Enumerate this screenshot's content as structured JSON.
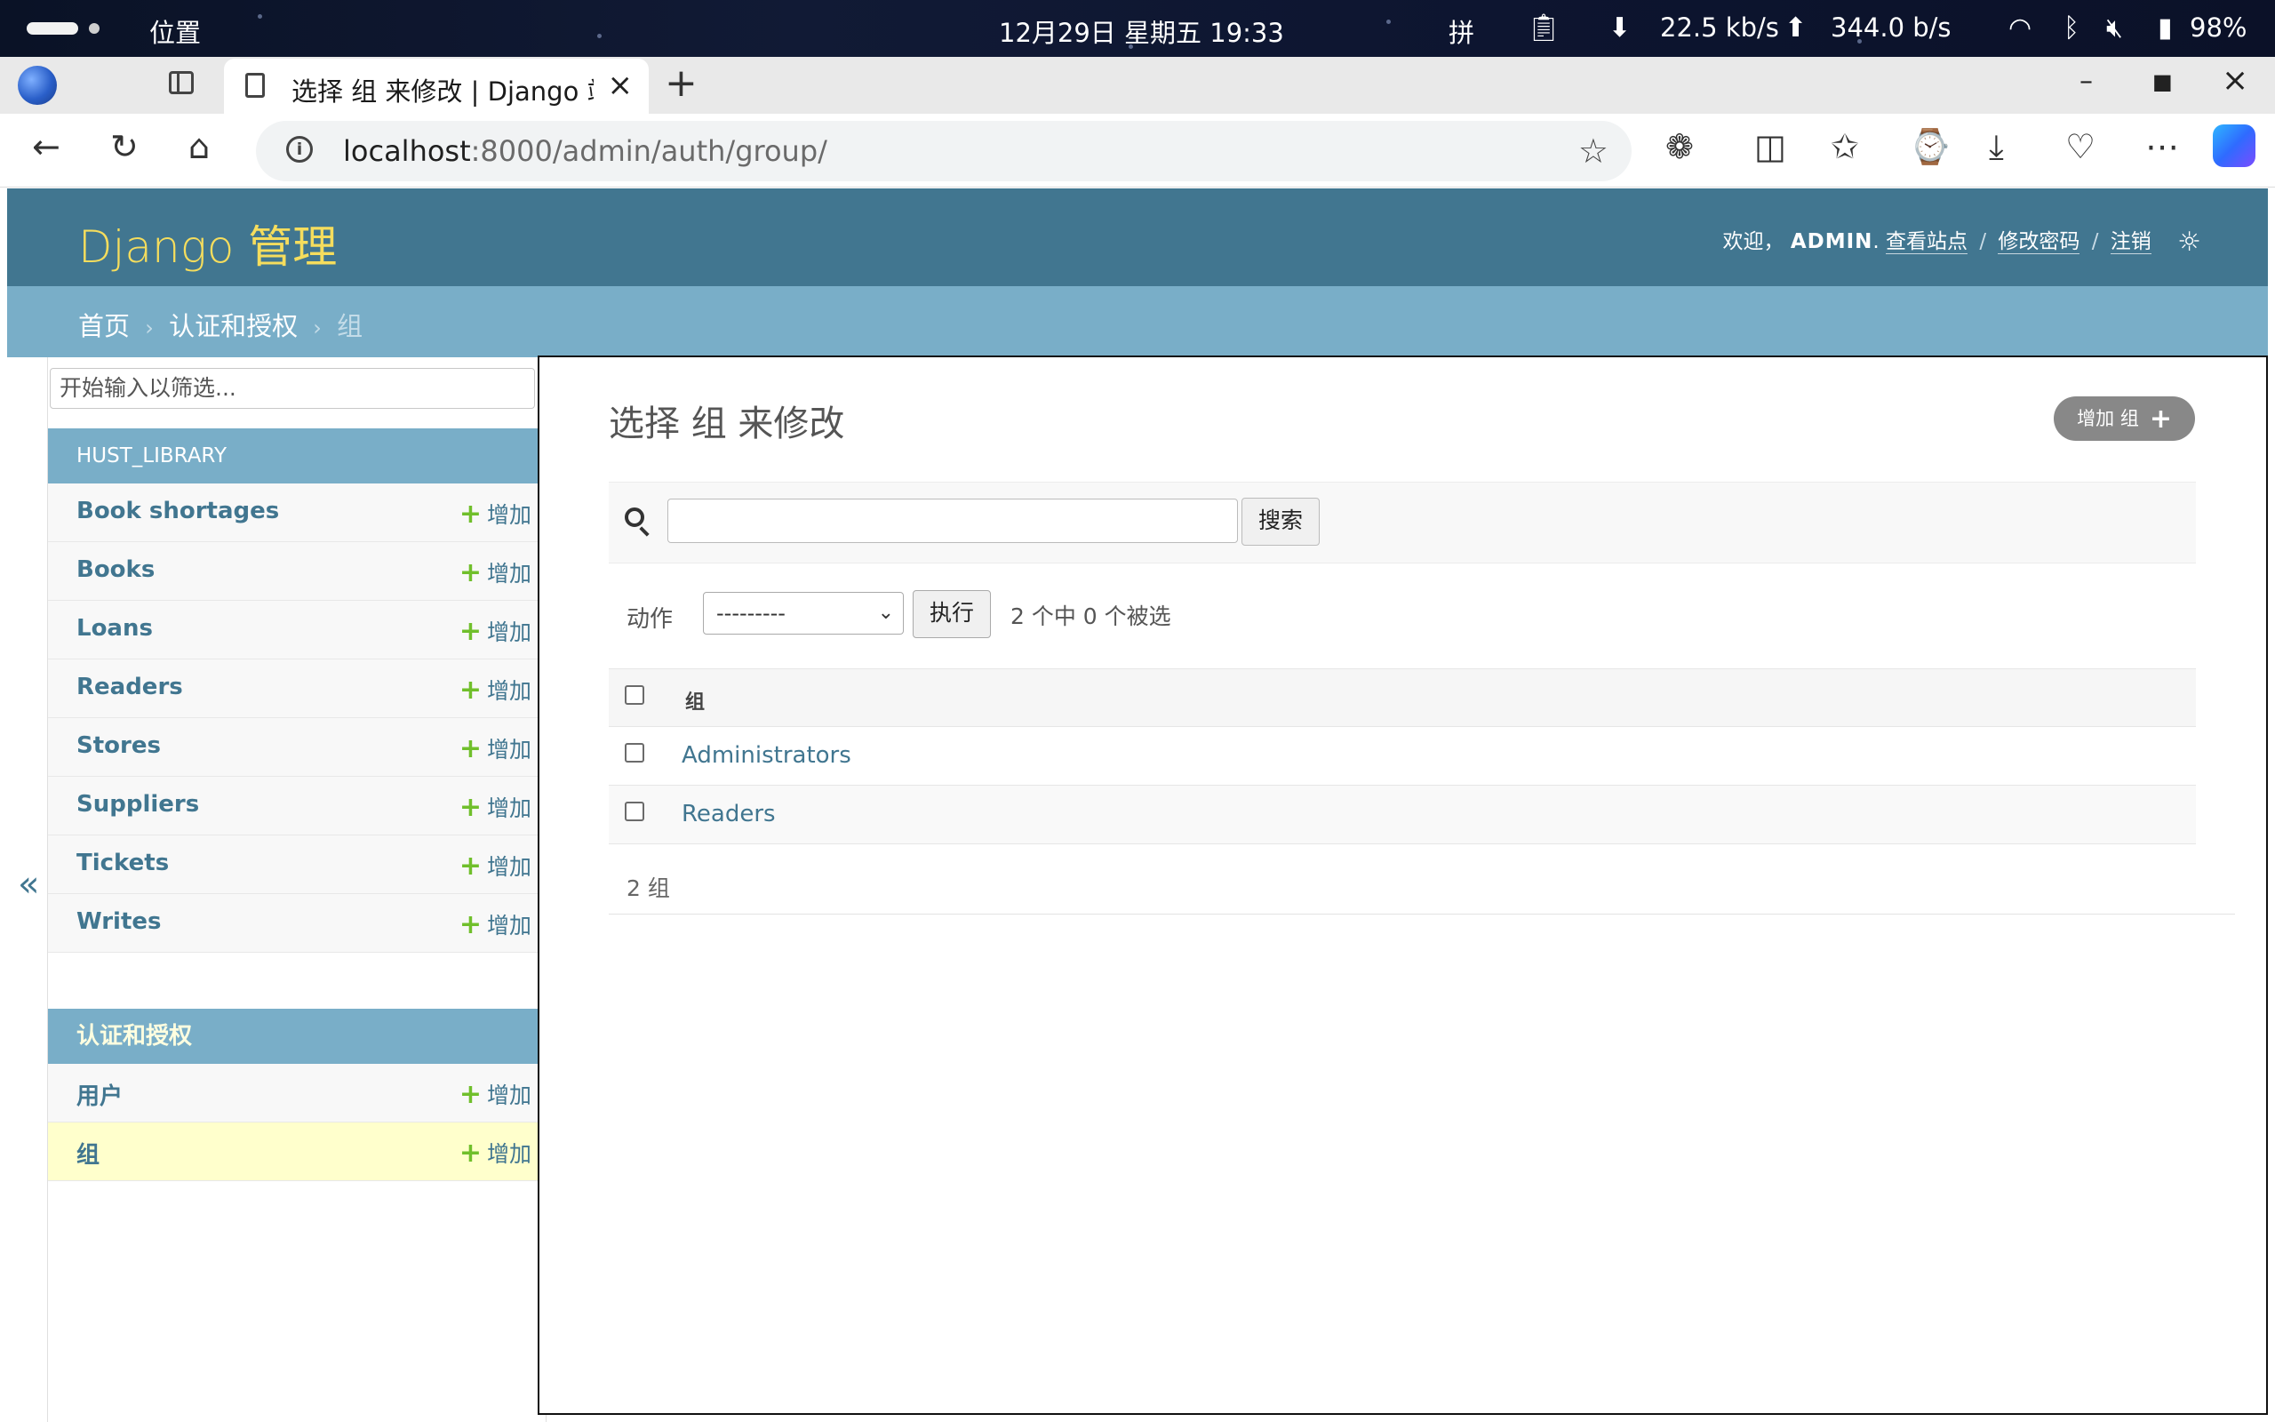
{
  "os": {
    "location_label": "位置",
    "datetime": "12月29日 星期五  19:33",
    "ime": "拼",
    "down_speed": "22.5 kb/s",
    "up_speed": "344.0 b/s",
    "battery": "98%"
  },
  "browser": {
    "tab_title": "选择 组 来修改 | Django 站",
    "url_host": "localhost",
    "url_rest": ":8000/admin/auth/group/"
  },
  "header": {
    "branding": "Django 管理",
    "welcome": "欢迎，",
    "username": "ADMIN",
    "username_suffix": ".",
    "view_site": "查看站点",
    "change_password": "修改密码",
    "logout": "注销"
  },
  "breadcrumbs": {
    "home": "首页",
    "app": "认证和授权",
    "current": "组",
    "separator": "›"
  },
  "sidebar": {
    "filter_placeholder": "开始输入以筛选...",
    "toggle": "«",
    "add_label": "增加",
    "module1": {
      "caption": "HUST_LIBRARY",
      "items": [
        {
          "label": "Book shortages"
        },
        {
          "label": "Books"
        },
        {
          "label": "Loans"
        },
        {
          "label": "Readers"
        },
        {
          "label": "Stores"
        },
        {
          "label": "Suppliers"
        },
        {
          "label": "Tickets"
        },
        {
          "label": "Writes"
        }
      ]
    },
    "module2": {
      "caption": "认证和授权",
      "items": [
        {
          "label": "用户"
        },
        {
          "label": "组"
        }
      ]
    }
  },
  "content": {
    "title": "选择 组 来修改",
    "add_button": "增加 组",
    "search_button": "搜索",
    "actions_label": "动作",
    "actions_select": "---------",
    "go_button": "执行",
    "counter": "2 个中 0 个被选",
    "column_header": "组",
    "rows": [
      {
        "name": "Administrators"
      },
      {
        "name": "Readers"
      }
    ],
    "paginator": "2 组"
  },
  "colors": {
    "header_bg": "#417690",
    "breadcrumb_bg": "#79aec8",
    "branding": "#f5dd5d",
    "link": "#417690",
    "add_plus": "#70bf2b",
    "current_row": "#ffffcc"
  }
}
